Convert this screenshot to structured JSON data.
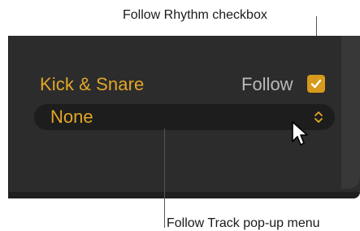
{
  "track": {
    "label": "Kick & Snare"
  },
  "follow": {
    "label": "Follow",
    "checked": true,
    "checkbox_color": "#d79a1c"
  },
  "popup": {
    "value": "None"
  },
  "callouts": {
    "follow_rhythm": "Follow Rhythm checkbox",
    "follow_track": "Follow Track pop-up menu"
  },
  "colors": {
    "panel_bg": "#2c2c2c",
    "accent": "#e2a727",
    "popup_bg": "#1d1d1d",
    "follow_text": "#b9b9b9"
  },
  "icons": {
    "checkbox": "checkmark-icon",
    "popup": "chevron-up-down-icon",
    "cursor": "mouse-pointer-icon"
  }
}
